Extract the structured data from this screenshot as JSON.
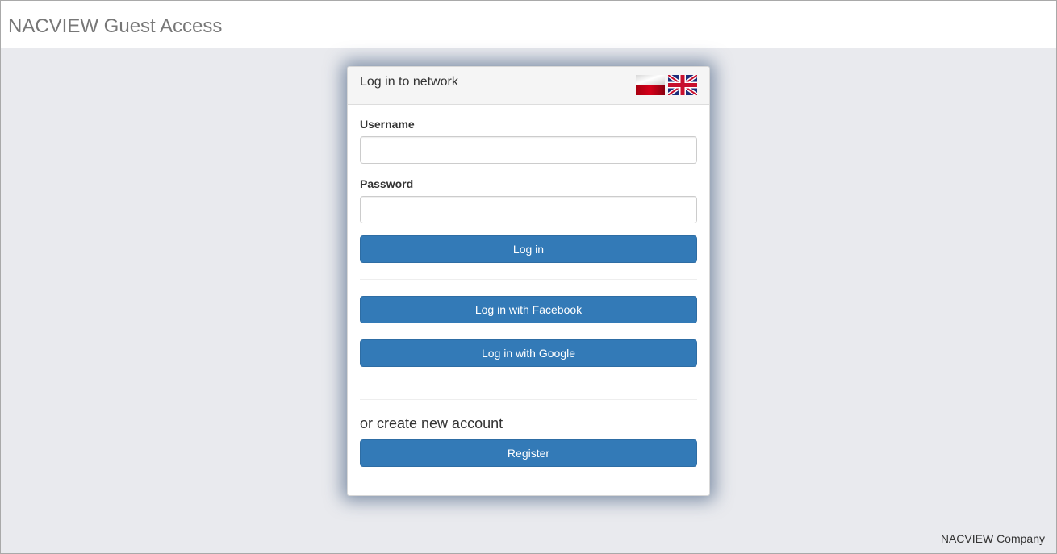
{
  "header": {
    "title": "NACVIEW Guest Access"
  },
  "login_panel": {
    "title": "Log in to network",
    "languages": [
      {
        "name": "Polish",
        "icon": "flag-pl-icon"
      },
      {
        "name": "English",
        "icon": "flag-gb-icon"
      }
    ],
    "username_label": "Username",
    "username_value": "",
    "password_label": "Password",
    "password_value": "",
    "login_button": "Log in",
    "facebook_button": "Log in with Facebook",
    "google_button": "Log in with Google",
    "create_account_text": "or create new account",
    "register_button": "Register"
  },
  "footer": {
    "company": "NACVIEW Company"
  },
  "colors": {
    "primary": "#337ab7",
    "background": "#e9eaee",
    "brand_text": "#777777"
  }
}
